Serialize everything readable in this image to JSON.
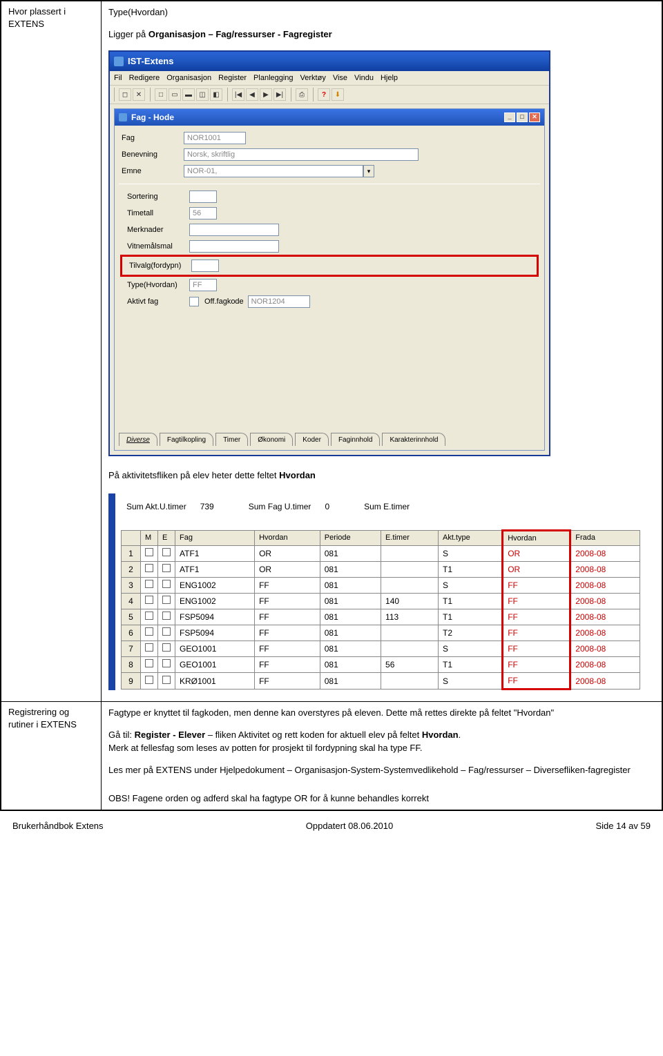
{
  "row1": {
    "left": "Hvor plassert i EXTENS",
    "typeline": "Type(Hvordan)",
    "ligger_pre": "Ligger på ",
    "ligger_bold": "Organisasjon – Fag/ressurser - Fagregister",
    "app_title": "IST-Extens",
    "menus": [
      "Fil",
      "Redigere",
      "Organisasjon",
      "Register",
      "Planlegging",
      "Verktøy",
      "Vise",
      "Vindu",
      "Hjelp"
    ],
    "toolbar_glyphs": {
      "doc": "◻",
      "close": "✕",
      "new": "□",
      "open": "▭",
      "save": "▬",
      "db": "◫",
      "y": "◧",
      "first": "|◀",
      "prev": "◀",
      "next": "▶",
      "last": "▶|",
      "print": "⎙",
      "help": "?",
      "warn": "⬇"
    },
    "subwindow_title": "Fag - Hode",
    "form": {
      "fag": {
        "label": "Fag",
        "value": "NOR1001"
      },
      "benevning": {
        "label": "Benevning",
        "value": "Norsk, skriftlig"
      },
      "emne": {
        "label": "Emne",
        "value": "NOR-01,"
      },
      "sortering": {
        "label": "Sortering",
        "value": ""
      },
      "timetall": {
        "label": "Timetall",
        "value": "56"
      },
      "merknader": {
        "label": "Merknader",
        "value": ""
      },
      "vitnemalsmal": {
        "label": "Vitnemålsmal",
        "value": ""
      },
      "tilvalg": {
        "label": "Tilvalg(fordypn)",
        "value": ""
      },
      "typehvordan": {
        "label": "Type(Hvordan)",
        "value": "FF"
      },
      "aktivt": {
        "label": "Aktivt fag",
        "offlabel": "Off.fagkode",
        "offvalue": "NOR1204"
      }
    },
    "tabs": [
      "Diverse",
      "Fagtilkopling",
      "Timer",
      "Økonomi",
      "Koder",
      "Faginnhold",
      "Karakterinnhold"
    ],
    "aktiv_caption": "På aktivitetsfliken på elev heter dette feltet ",
    "aktiv_bold": "Hvordan",
    "sumline": {
      "a_lbl": "Sum Akt.U.timer",
      "a_val": "739",
      "b_lbl": "Sum Fag U.timer",
      "b_val": "0",
      "c_lbl": "Sum E.timer"
    },
    "grid_headers": [
      "",
      "M",
      "E",
      "Fag",
      "Hvordan",
      "Periode",
      "E.timer",
      "Akt.type",
      "Hvordan",
      "Frada"
    ],
    "grid_rows": [
      {
        "n": "1",
        "fag": "ATF1",
        "h": "OR",
        "p": "081",
        "et": "",
        "at": "S",
        "h2": "OR",
        "fr": "2008-08"
      },
      {
        "n": "2",
        "fag": "ATF1",
        "h": "OR",
        "p": "081",
        "et": "",
        "at": "T1",
        "h2": "OR",
        "fr": "2008-08"
      },
      {
        "n": "3",
        "fag": "ENG1002",
        "h": "FF",
        "p": "081",
        "et": "",
        "at": "S",
        "h2": "FF",
        "fr": "2008-08"
      },
      {
        "n": "4",
        "fag": "ENG1002",
        "h": "FF",
        "p": "081",
        "et": "140",
        "at": "T1",
        "h2": "FF",
        "fr": "2008-08"
      },
      {
        "n": "5",
        "fag": "FSP5094",
        "h": "FF",
        "p": "081",
        "et": "113",
        "at": "T1",
        "h2": "FF",
        "fr": "2008-08"
      },
      {
        "n": "6",
        "fag": "FSP5094",
        "h": "FF",
        "p": "081",
        "et": "",
        "at": "T2",
        "h2": "FF",
        "fr": "2008-08"
      },
      {
        "n": "7",
        "fag": "GEO1001",
        "h": "FF",
        "p": "081",
        "et": "",
        "at": "S",
        "h2": "FF",
        "fr": "2008-08"
      },
      {
        "n": "8",
        "fag": "GEO1001",
        "h": "FF",
        "p": "081",
        "et": "56",
        "at": "T1",
        "h2": "FF",
        "fr": "2008-08"
      },
      {
        "n": "9",
        "fag": "KRØ1001",
        "h": "FF",
        "p": "081",
        "et": "",
        "at": "S",
        "h2": "FF",
        "fr": "2008-08"
      }
    ]
  },
  "row2": {
    "left": "Registrering og rutiner i EXTENS",
    "p1": "Fagtype er knyttet til fagkoden, men denne kan overstyres på eleven. Dette må rettes direkte på feltet \"Hvordan\"",
    "p2_pre": "Gå til:  ",
    "p2_bold1": "Register - Elever",
    "p2_mid": " – fliken Aktivitet og rett koden for aktuell elev på feltet ",
    "p2_bold2": "Hvordan",
    "p2_post": ".",
    "p3": "Merk at fellesfag som leses av potten for prosjekt til fordypning skal ha type FF.",
    "p4": "Les mer på EXTENS under Hjelpedokument – Organisasjon-System-Systemvedlikehold – Fag/ressurser – Diversefliken-fagregister",
    "p5": "OBS! Fagene orden og adferd skal ha fagtype OR for å kunne behandles korrekt"
  },
  "footer": {
    "left": "Brukerhåndbok Extens",
    "mid": "Oppdatert 08.06.2010",
    "right": "Side 14  av 59"
  }
}
